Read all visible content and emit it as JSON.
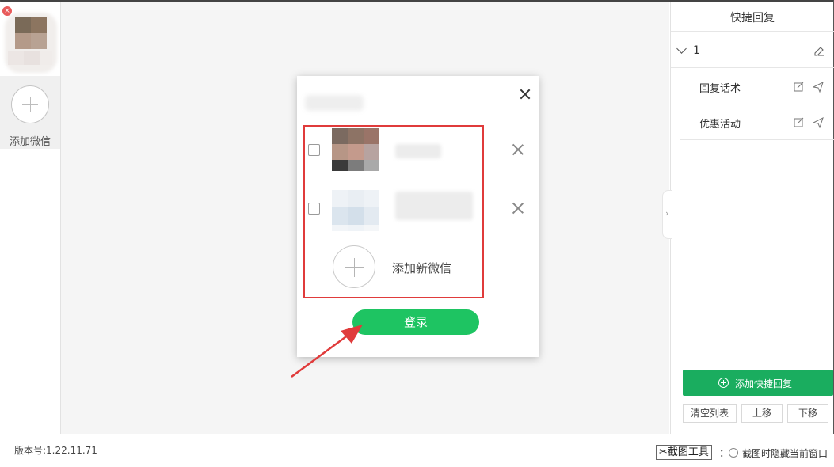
{
  "sidebar": {
    "add_label": "添加微信",
    "close_badge": "×"
  },
  "right_panel": {
    "title": "快捷回复",
    "group": {
      "name": "1"
    },
    "items": [
      {
        "label": "回复话术"
      },
      {
        "label": "优惠活动"
      }
    ],
    "add_button": "添加快捷回复",
    "clear_button": "清空列表",
    "up_button": "上移",
    "down_button": "下移",
    "handle_glyph": "›"
  },
  "dialog": {
    "add_new_label": "添加新微信",
    "login_button": "登录"
  },
  "footer": {
    "version": "版本号:1.22.11.71",
    "screenshot_tool": "截图工具",
    "separator": "：",
    "hide_option": "截图时隐藏当前窗口"
  },
  "colors": {
    "accent_green": "#1ec462",
    "button_green": "#1aad5f",
    "highlight_red": "#e03b3b"
  }
}
